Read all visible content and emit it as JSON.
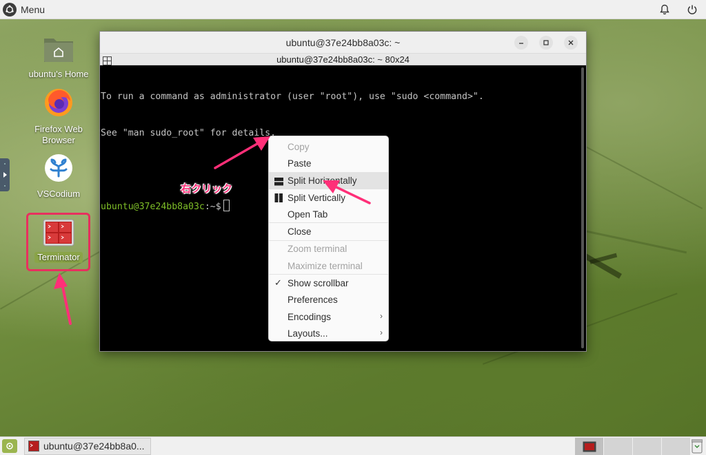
{
  "top_panel": {
    "menu_label": "Menu"
  },
  "desktop": {
    "icons": [
      {
        "label": "ubuntu's Home"
      },
      {
        "label": "Firefox Web Browser"
      },
      {
        "label": "VSCodium"
      },
      {
        "label": "Terminator"
      }
    ]
  },
  "window": {
    "title": "ubuntu@37e24bb8a03c: ~",
    "terminal_title": "ubuntu@37e24bb8a03c: ~ 80x24",
    "lines": [
      "To run a command as administrator (user \"root\"), use \"sudo <command>\".",
      "See \"man sudo_root\" for details."
    ],
    "prompt_user": "ubuntu@37e24bb8a03c",
    "prompt_rest": ":~$"
  },
  "context_menu": {
    "items": [
      {
        "label": "Copy",
        "disabled": true
      },
      {
        "label": "Paste"
      },
      {
        "label": "Split Horizontally",
        "icon": "split-horizontal-icon"
      },
      {
        "label": "Split Vertically",
        "icon": "split-vertical-icon"
      },
      {
        "label": "Open Tab"
      },
      {
        "label": "Close"
      },
      {
        "label": "Zoom terminal",
        "disabled": true
      },
      {
        "label": "Maximize terminal",
        "disabled": true
      },
      {
        "label": "Show scrollbar",
        "checked": true
      },
      {
        "label": "Preferences"
      },
      {
        "label": "Encodings",
        "submenu": true
      },
      {
        "label": "Layouts...",
        "submenu": true
      }
    ]
  },
  "annotation": {
    "text": "右クリック",
    "color": "#ff2f78"
  },
  "taskbar": {
    "task_label": "ubuntu@37e24bb8a0..."
  },
  "colors": {
    "prompt": "#7fbf28",
    "accent_pink": "#e8305f",
    "panel": "#f0f0f0"
  }
}
